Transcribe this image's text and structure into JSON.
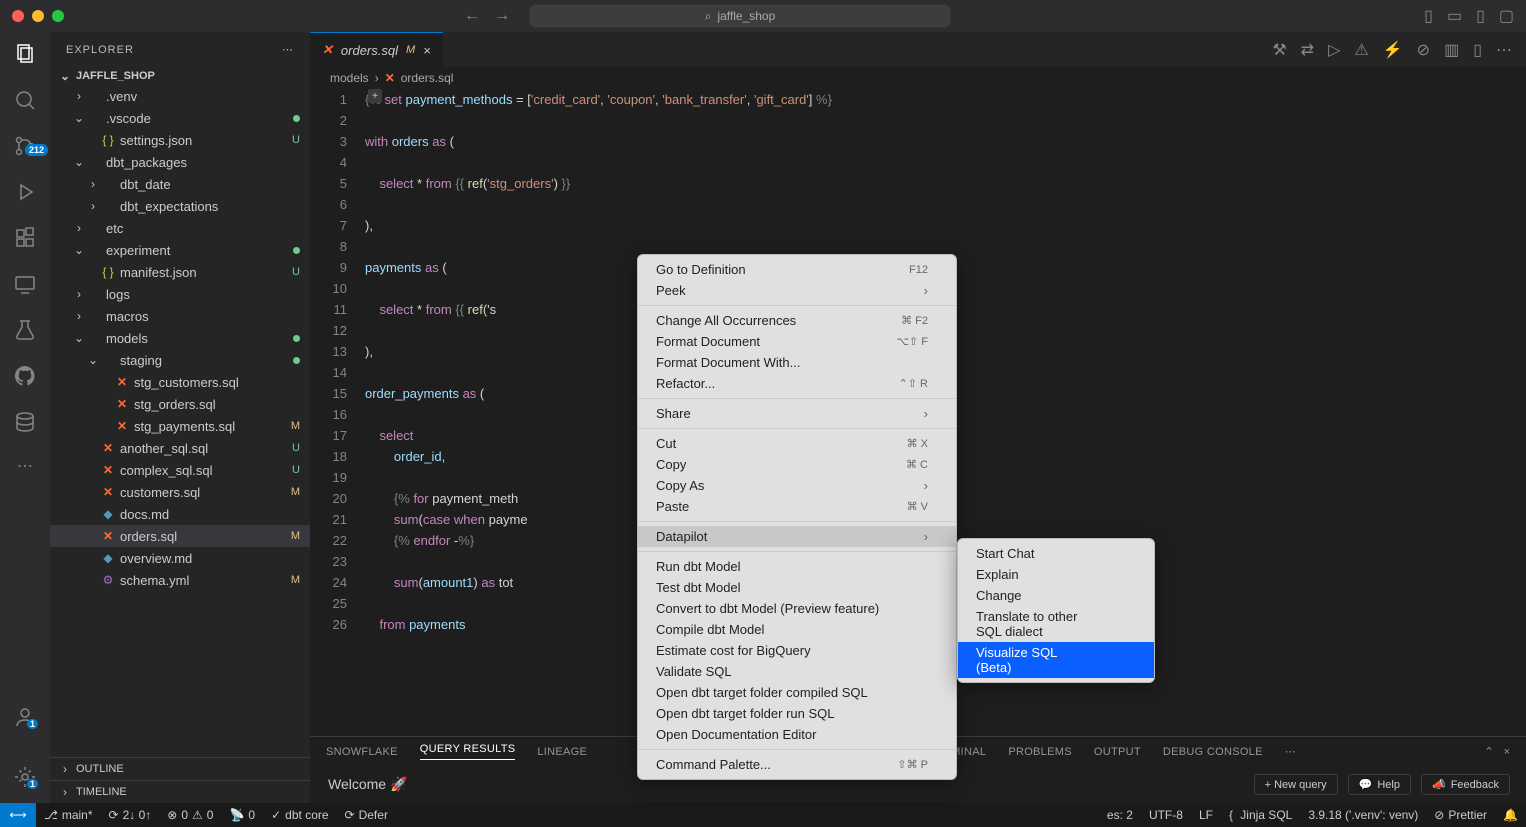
{
  "title": "jaffle_shop",
  "explorer": {
    "label": "EXPLORER",
    "root": "JAFFLE_SHOP"
  },
  "activity_badge": "212",
  "tree": [
    {
      "d": 1,
      "chev": "›",
      "name": ".venv",
      "type": "folder"
    },
    {
      "d": 1,
      "chev": "⌄",
      "name": ".vscode",
      "type": "folder",
      "dot": true
    },
    {
      "d": 2,
      "name": "settings.json",
      "type": "json",
      "status": "U"
    },
    {
      "d": 1,
      "chev": "⌄",
      "name": "dbt_packages",
      "type": "folder"
    },
    {
      "d": 2,
      "chev": "›",
      "name": "dbt_date",
      "type": "folder"
    },
    {
      "d": 2,
      "chev": "›",
      "name": "dbt_expectations",
      "type": "folder"
    },
    {
      "d": 1,
      "chev": "›",
      "name": "etc",
      "type": "folder"
    },
    {
      "d": 1,
      "chev": "⌄",
      "name": "experiment",
      "type": "folder",
      "dot": true
    },
    {
      "d": 2,
      "name": "manifest.json",
      "type": "json",
      "status": "U"
    },
    {
      "d": 1,
      "chev": "›",
      "name": "logs",
      "type": "folder"
    },
    {
      "d": 1,
      "chev": "›",
      "name": "macros",
      "type": "folder"
    },
    {
      "d": 1,
      "chev": "⌄",
      "name": "models",
      "type": "folder",
      "dot": true
    },
    {
      "d": 2,
      "chev": "⌄",
      "name": "staging",
      "type": "folder",
      "dot": true
    },
    {
      "d": 3,
      "name": "stg_customers.sql",
      "type": "dbt"
    },
    {
      "d": 3,
      "name": "stg_orders.sql",
      "type": "dbt"
    },
    {
      "d": 3,
      "name": "stg_payments.sql",
      "type": "dbt",
      "status": "M"
    },
    {
      "d": 2,
      "name": "another_sql.sql",
      "type": "dbt",
      "status": "U"
    },
    {
      "d": 2,
      "name": "complex_sql.sql",
      "type": "dbt",
      "status": "U"
    },
    {
      "d": 2,
      "name": "customers.sql",
      "type": "dbt",
      "status": "M"
    },
    {
      "d": 2,
      "name": "docs.md",
      "type": "md"
    },
    {
      "d": 2,
      "name": "orders.sql",
      "type": "dbt",
      "status": "M",
      "selected": true
    },
    {
      "d": 2,
      "name": "overview.md",
      "type": "md"
    },
    {
      "d": 2,
      "name": "schema.yml",
      "type": "yml",
      "status": "M"
    }
  ],
  "outline": "OUTLINE",
  "timeline": "TIMELINE",
  "tab": {
    "name": "orders.sql",
    "status": "M"
  },
  "breadcrumb": [
    "models",
    "orders.sql"
  ],
  "code_lines": [
    "{% set payment_methods = ['credit_card', 'coupon', 'bank_transfer', 'gift_card'] %}",
    "",
    "with orders as (",
    "",
    "    select * from {{ ref('stg_orders') }}",
    "",
    "),",
    "",
    "payments as (",
    "",
    "    select * from {{ ref('s",
    "",
    "),",
    "",
    "order_payments as (",
    "",
    "    select",
    "        order_id,",
    "",
    "        {% for payment_meth",
    "        sum(case when payme                                                        s {{ payment_method }}_amount,",
    "        {% endfor -%}",
    "",
    "        sum(amount1) as tot",
    "",
    "    from payments"
  ],
  "panel_tabs": [
    "SNOWFLAKE",
    "QUERY RESULTS",
    "LINEAGE",
    "",
    "",
    "",
    "MINAL",
    "PROBLEMS",
    "OUTPUT",
    "DEBUG CONSOLE"
  ],
  "panel_active": "QUERY RESULTS",
  "welcome": "Welcome 🚀",
  "buttons": {
    "new_query": "+ New query",
    "help": "Help",
    "feedback": "Feedback"
  },
  "status": {
    "branch": "main*",
    "sync": "2↓ 0↑",
    "errors": "0",
    "warnings": "0",
    "radio": "0",
    "dbt": "dbt core",
    "defer": "Defer",
    "spaces": "es: 2",
    "encoding": "UTF-8",
    "eol": "LF",
    "lang": "Jinja SQL",
    "python": "3.9.18 ('.venv': venv)",
    "prettier": "Prettier"
  },
  "ctx1": [
    {
      "label": "Go to Definition",
      "kb": "F12"
    },
    {
      "label": "Peek",
      "sub": true
    },
    {
      "sep": true
    },
    {
      "label": "Change All Occurrences",
      "kb": "⌘ F2"
    },
    {
      "label": "Format Document",
      "kb": "⌥⇧ F"
    },
    {
      "label": "Format Document With..."
    },
    {
      "label": "Refactor...",
      "kb": "⌃⇧ R"
    },
    {
      "sep": true
    },
    {
      "label": "Share",
      "sub": true
    },
    {
      "sep": true
    },
    {
      "label": "Cut",
      "kb": "⌘ X"
    },
    {
      "label": "Copy",
      "kb": "⌘ C"
    },
    {
      "label": "Copy As",
      "sub": true
    },
    {
      "label": "Paste",
      "kb": "⌘ V"
    },
    {
      "sep": true
    },
    {
      "label": "Datapilot",
      "sub": true,
      "hl": true
    },
    {
      "sep": true
    },
    {
      "label": "Run dbt Model"
    },
    {
      "label": "Test dbt Model"
    },
    {
      "label": "Convert to dbt Model (Preview feature)"
    },
    {
      "label": "Compile dbt Model"
    },
    {
      "label": "Estimate cost for BigQuery"
    },
    {
      "label": "Validate SQL"
    },
    {
      "label": "Open dbt target folder compiled SQL"
    },
    {
      "label": "Open dbt target folder run SQL"
    },
    {
      "label": "Open Documentation Editor"
    },
    {
      "sep": true
    },
    {
      "label": "Command Palette...",
      "kb": "⇧⌘ P"
    }
  ],
  "ctx2": [
    {
      "label": "Start Chat"
    },
    {
      "label": "Explain"
    },
    {
      "label": "Change"
    },
    {
      "label": "Translate to other SQL dialect"
    },
    {
      "label": "Visualize SQL (Beta)",
      "sel": true
    }
  ]
}
